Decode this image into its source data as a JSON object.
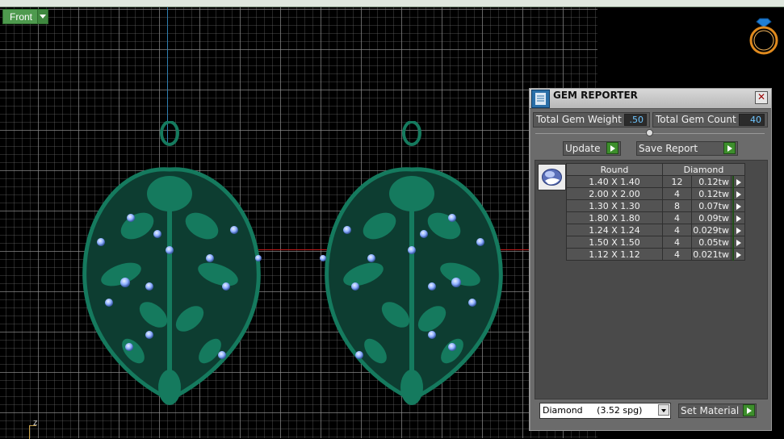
{
  "viewport": {
    "view_label": "Front",
    "axis_label": "z"
  },
  "gem_reporter": {
    "title": "GEM REPORTER",
    "close_glyph": "✕",
    "total_weight_label": "Total Gem Weight",
    "total_weight_value": ".50",
    "total_count_label": "Total Gem Count",
    "total_count_value": "40",
    "update_label": "Update",
    "save_report_label": "Save Report",
    "shape_header": "Round",
    "material_header": "Diamond",
    "rows": [
      {
        "size": "1.40 X 1.40",
        "count": "12",
        "weight": "0.12tw"
      },
      {
        "size": "2.00 X 2.00",
        "count": "4",
        "weight": "0.12tw"
      },
      {
        "size": "1.30 X 1.30",
        "count": "8",
        "weight": "0.07tw"
      },
      {
        "size": "1.80 X 1.80",
        "count": "4",
        "weight": "0.09tw"
      },
      {
        "size": "1.24 X 1.24",
        "count": "4",
        "weight": "0.029tw"
      },
      {
        "size": "1.50 X 1.50",
        "count": "4",
        "weight": "0.05tw"
      },
      {
        "size": "1.12 X 1.12",
        "count": "4",
        "weight": "0.021tw"
      }
    ],
    "material_select_value": "Diamond     (3.52 spg)",
    "set_material_label": "Set Material"
  },
  "icons": {
    "ring": "ring-diamond-icon",
    "gem": "round-gem-icon",
    "reporter": "report-sheet-icon"
  },
  "colors": {
    "model_green": "#157a5e",
    "accent_green": "#3d8f2c",
    "value_blue": "#6fc6ff",
    "gem_blue": "#8fb0ff"
  }
}
